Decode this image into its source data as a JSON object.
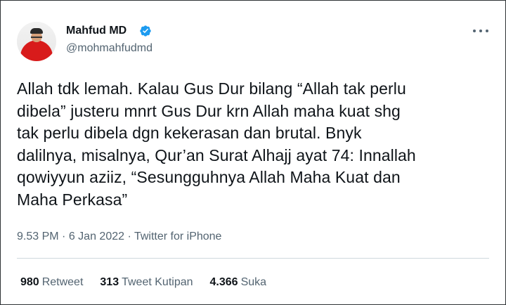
{
  "author": {
    "name": "Mahfud MD",
    "handle": "@mohmahfudmd"
  },
  "icons": {
    "verified": "verified-badge-icon",
    "more": "more-options-icon"
  },
  "colors": {
    "verified": "#1d9bf0",
    "secondary_text": "#536471",
    "primary_text": "#0f1419"
  },
  "tweet": {
    "lines": [
      "Allah tdk lemah. Kalau Gus Dur bilang “Allah tak perlu",
      "dibela” justeru mnrt Gus Dur krn Allah maha kuat shg",
      "tak perlu dibela dgn kekerasan dan brutal. Bnyk",
      "dalilnya, misalnya, Qur’an Surat Alhajj ayat 74: Innallah",
      "qowiyyun aziiz, “Sesungguhnya Allah Maha Kuat dan",
      "Maha Perkasa”"
    ]
  },
  "meta": {
    "time": "9.53 PM",
    "separator1": "·",
    "date": "6 Jan 2022",
    "separator2": "·",
    "source": "Twitter for iPhone"
  },
  "stats": {
    "retweets": {
      "count": "980",
      "label": "Retweet"
    },
    "quotes": {
      "count": "313",
      "label": "Tweet Kutipan"
    },
    "likes": {
      "count": "4.366",
      "label": "Suka"
    }
  }
}
